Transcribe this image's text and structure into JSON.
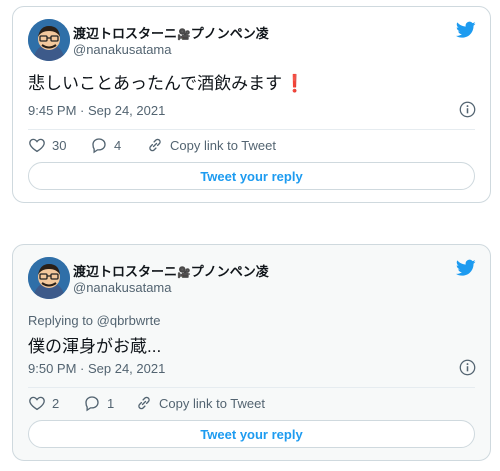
{
  "colors": {
    "accent": "#1d9bf0",
    "secondary_text": "#536471",
    "border": "#cfd9de",
    "exclamation": "#e0245e"
  },
  "tweets": [
    {
      "author_name": "渡辺トロスターニ",
      "author_name_suffix": "プノンペン凌",
      "name_icon": "movie-camera-icon",
      "handle": "@nanakusatama",
      "replying_to": "",
      "text": "悲しいことあったんで酒飲みます",
      "text_emoji": "❗",
      "timestamp": "9:45 PM · Sep 24, 2021",
      "likes": "30",
      "replies": "4",
      "copy_link_label": "Copy link to Tweet",
      "reply_button_label": "Tweet your reply"
    },
    {
      "author_name": "渡辺トロスターニ",
      "author_name_suffix": "プノンペン凌",
      "name_icon": "movie-camera-icon",
      "handle": "@nanakusatama",
      "replying_to": "Replying to @qbrbwrte",
      "text": "僕の渾身がお蔵...",
      "timestamp": "9:50 PM · Sep 24, 2021",
      "likes": "2",
      "replies": "1",
      "copy_link_label": "Copy link to Tweet",
      "reply_button_label": "Tweet your reply"
    }
  ]
}
